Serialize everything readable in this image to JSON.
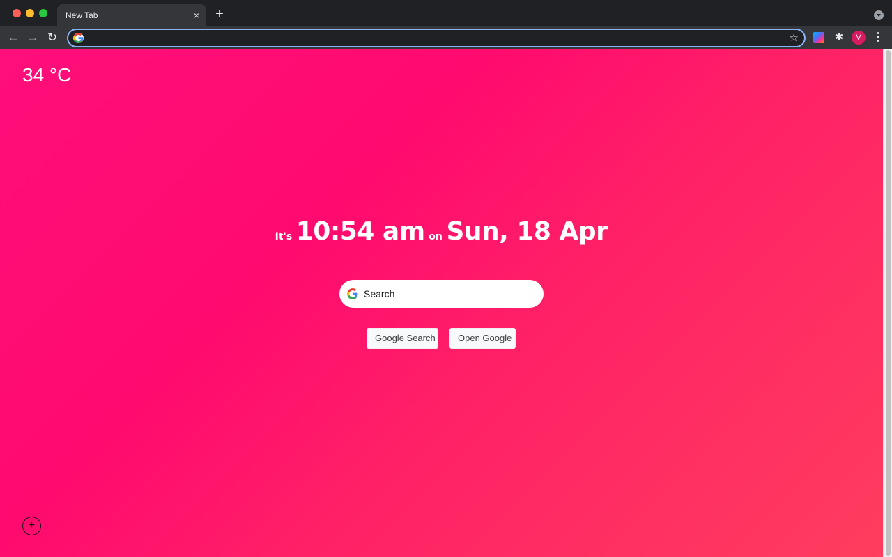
{
  "browser": {
    "tab_title": "New Tab",
    "tab_close_icon": "close-icon",
    "new_tab_icon": "plus-icon",
    "address_value": "",
    "profile_initial": "V",
    "icons": {
      "close": "×",
      "plus": "+",
      "back": "←",
      "forward": "→",
      "reload": "↻",
      "star": "☆",
      "puzzle": "✱",
      "menu": "⋮"
    }
  },
  "page": {
    "weather": "34 °C",
    "clock": {
      "prefix": "It's",
      "time": "10:54 am",
      "joiner": "on",
      "date": "Sun, 18 Apr"
    },
    "search": {
      "placeholder": "Search"
    },
    "buttons": {
      "google_search": "Google Search",
      "open_google": "Open Google"
    },
    "add_icon": "+"
  },
  "colors": {
    "accent_gradient_start": "#ff0f7b",
    "accent_gradient_end": "#ff3d5e",
    "chrome_dark": "#202124",
    "avatar": "#d81b60"
  }
}
